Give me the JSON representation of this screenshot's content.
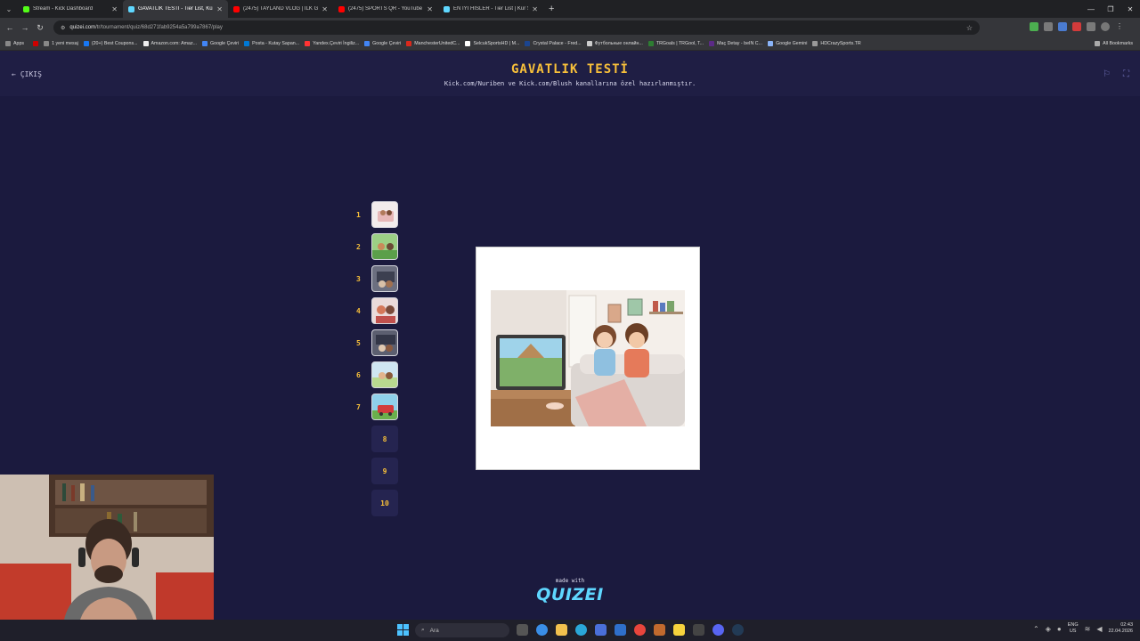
{
  "browser": {
    "tabs": [
      {
        "title": "Stream - Kick Dashboard",
        "color": "#53fc18",
        "active": false
      },
      {
        "title": "GAVATLIK TESTİ - Tier List, Kür...",
        "color": "#5fd7ff",
        "active": true
      },
      {
        "title": "(2475) TAYLAND VLOG | İLK GÜ...",
        "color": "#ff0000",
        "active": false
      },
      {
        "title": "(2475) SPORTS QR - YouTube",
        "color": "#ff0000",
        "active": false
      },
      {
        "title": "EN İYİ HİSLER - Tier List | Kür S...",
        "color": "#5fd7ff",
        "active": false
      }
    ],
    "url_host": "quizei.com",
    "url_path": "/tr/tournament/quiz/68d271fab9254a5a799a7867/play",
    "bookmarks": [
      "Apps",
      "1 yeni mesaj",
      "(20+) Best Coupons...",
      "Amazon.com: Amaz...",
      "Google Çeviri",
      "Posta - Kutay Sapan...",
      "Yandex.Çeviri İngiliz...",
      "Google Çeviri",
      "ManchesterUnitedC...",
      "SelcukSportsHD | M...",
      "Crystal Palace - Fred...",
      "Футбольные онлайн...",
      "TRGoals | TRGool, T...",
      "Maç Detay - beIN C...",
      "Google Gemini",
      "HDCrazySports.TR"
    ],
    "all_bookmarks": "All Bookmarks"
  },
  "page": {
    "exit_label": "ÇIKIŞ",
    "title": "GAVATLIK TESTİ",
    "subtitle": "Kick.com/Nuriben ve Kick.com/Blush kanallarına özel hazırlanmıştır.",
    "ranks": [
      {
        "num": "1",
        "filled": true
      },
      {
        "num": "2",
        "filled": true
      },
      {
        "num": "3",
        "filled": true
      },
      {
        "num": "4",
        "filled": true
      },
      {
        "num": "5",
        "filled": true
      },
      {
        "num": "6",
        "filled": true
      },
      {
        "num": "7",
        "filled": true
      },
      {
        "num": "8",
        "filled": false
      },
      {
        "num": "9",
        "filled": false
      },
      {
        "num": "10",
        "filled": false
      }
    ],
    "made_with": "made with",
    "brand": "QUIZEI"
  },
  "taskbar": {
    "search_placeholder": "Ara",
    "lang_top": "ENG",
    "lang_bottom": "US",
    "time": "02:43",
    "date": "22.04.2026"
  }
}
